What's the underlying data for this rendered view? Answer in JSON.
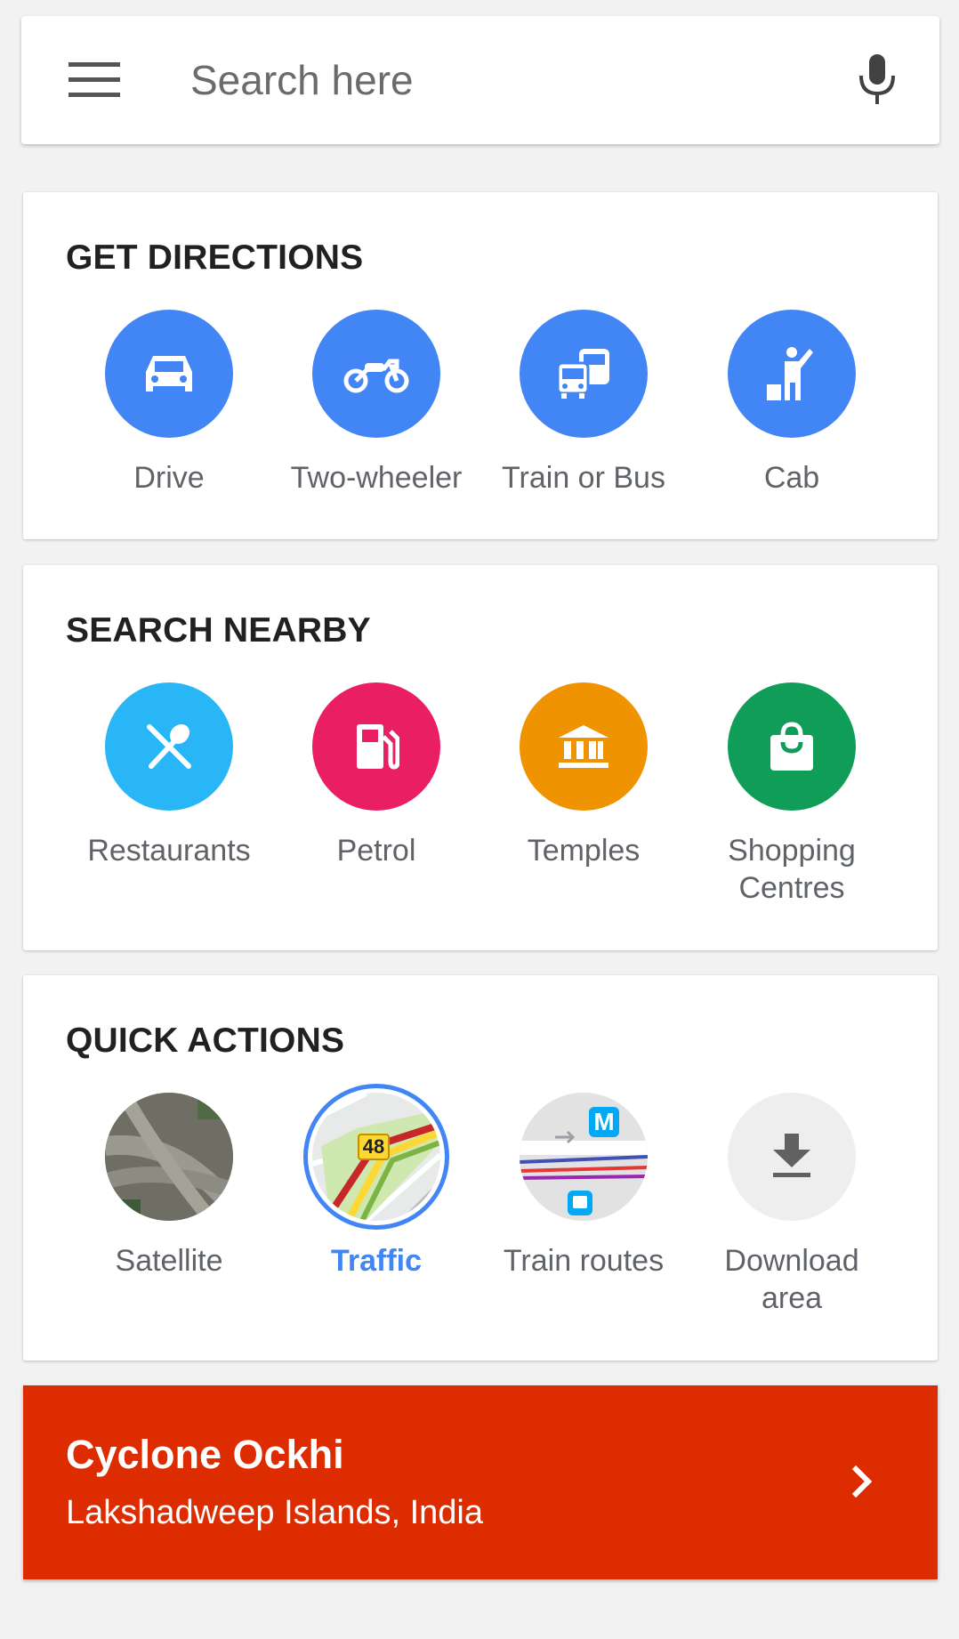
{
  "search": {
    "placeholder": "Search here",
    "menu_icon": "hamburger-menu-icon",
    "mic_icon": "microphone-icon"
  },
  "directions": {
    "title": "GET DIRECTIONS",
    "items": [
      {
        "label": "Drive",
        "icon": "car-icon"
      },
      {
        "label": "Two-wheeler",
        "icon": "motorbike-icon"
      },
      {
        "label": "Train or Bus",
        "icon": "transit-icon"
      },
      {
        "label": "Cab",
        "icon": "hail-cab-icon"
      }
    ]
  },
  "nearby": {
    "title": "SEARCH NEARBY",
    "items": [
      {
        "label": "Restaurants",
        "icon": "restaurant-icon",
        "color": "#29b6f6"
      },
      {
        "label": "Petrol",
        "icon": "fuel-pump-icon",
        "color": "#e91e63"
      },
      {
        "label": "Temples",
        "icon": "temple-icon",
        "color": "#f09300"
      },
      {
        "label": "Shopping Centres",
        "icon": "shopping-bag-icon",
        "color": "#0f9d58"
      }
    ]
  },
  "quick": {
    "title": "QUICK ACTIONS",
    "items": [
      {
        "label": "Satellite",
        "icon": "satellite-thumbnail"
      },
      {
        "label": "Traffic",
        "icon": "traffic-thumbnail",
        "badge": "48",
        "selected": true
      },
      {
        "label": "Train routes",
        "icon": "train-routes-thumbnail",
        "badge": "M"
      },
      {
        "label": "Download area",
        "icon": "download-icon"
      }
    ]
  },
  "alert": {
    "title": "Cyclone Ockhi",
    "subtitle": "Lakshadweep Islands, India",
    "color": "#dd2c00"
  },
  "colors": {
    "accent": "#4285f4",
    "background": "#f2f2f2"
  }
}
